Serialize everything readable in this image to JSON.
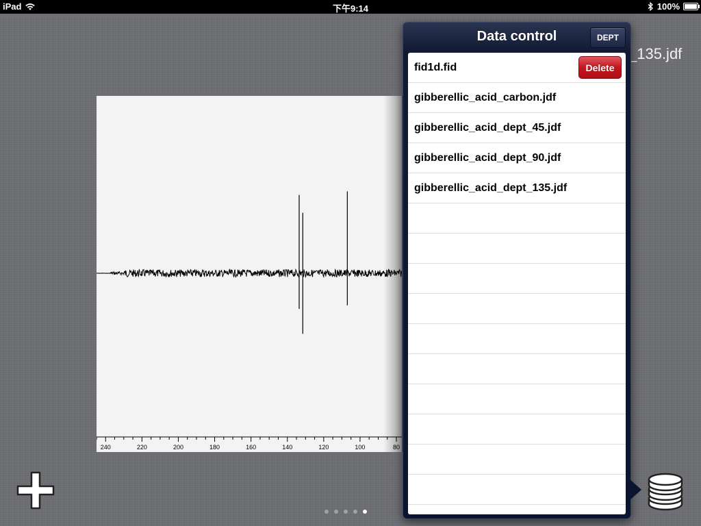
{
  "status_bar": {
    "device": "iPad",
    "time": "下午9:14",
    "battery": "100%"
  },
  "background_title": "_135.jdf",
  "spectrum": {
    "x_ticks": [
      "240",
      "220",
      "200",
      "180",
      "160",
      "140",
      "120",
      "100",
      "80"
    ],
    "x_range": [
      245,
      77
    ],
    "peaks": [
      {
        "ppm": 133.5,
        "up": 0.22,
        "down": 0.1
      },
      {
        "ppm": 131.5,
        "up": 0.17,
        "down": 0.17
      },
      {
        "ppm": 107.0,
        "up": 0.23,
        "down": 0.09
      }
    ]
  },
  "popover": {
    "title": "Data control",
    "dept_label": "DEPT",
    "delete_label": "Delete",
    "files": [
      "fid1d.fid",
      "gibberellic_acid_carbon.jdf",
      "gibberellic_acid_dept_45.jdf",
      "gibberellic_acid_dept_90.jdf",
      "gibberellic_acid_dept_135.jdf"
    ],
    "empty_rows": 10
  },
  "page_control": {
    "count": 5,
    "current": 5
  },
  "icons": {
    "add": "plus-icon",
    "database": "database-icon",
    "wifi": "wifi-icon",
    "bluetooth": "bluetooth-icon",
    "battery": "battery-icon"
  }
}
